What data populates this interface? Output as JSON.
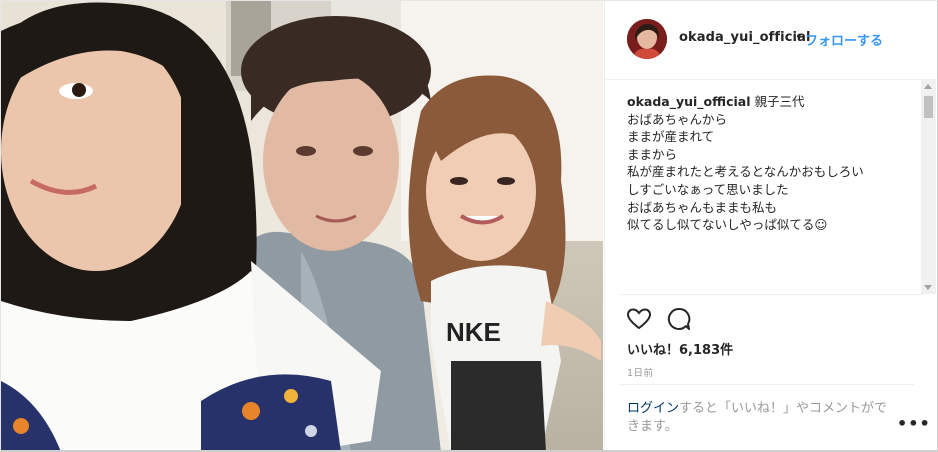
{
  "header": {
    "username": "okada_yui_official",
    "separator": "•",
    "follow_label": "フォローする"
  },
  "caption": {
    "username": "okada_yui_official",
    "lines": [
      "親子三代",
      "おばあちゃんから",
      "ままが産まれて",
      "ままから",
      "私が産まれたと考えるとなんかおもしろい",
      "しすごいなぁって思いました",
      "おばあちゃんもままも私も",
      "似てるし似てないしやっぱ似てる☺"
    ]
  },
  "actions": {
    "like_icon": "heart-icon",
    "comment_icon": "comment-icon"
  },
  "likes": {
    "text": "いいね！6,183件"
  },
  "date": "1日前",
  "footer": {
    "login_link": "ログイン",
    "login_rest": "すると「いいね！」やコメントができます。",
    "more_label": "•••"
  },
  "colors": {
    "link": "#3897f0",
    "login": "#003569",
    "muted": "#999999",
    "text": "#262626"
  }
}
